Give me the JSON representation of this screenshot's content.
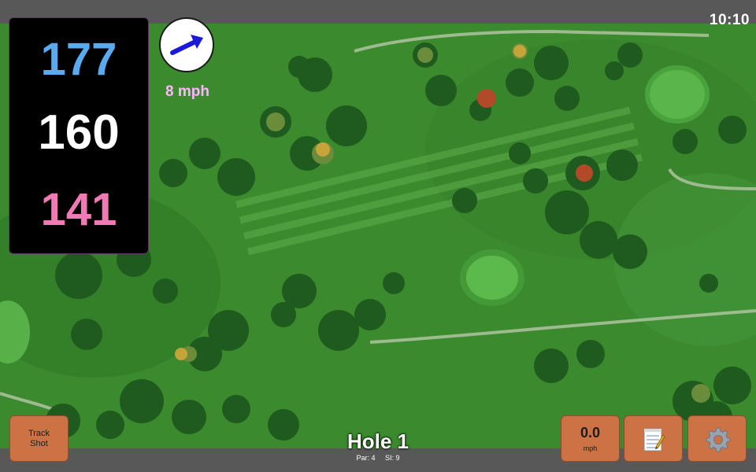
{
  "status": {
    "time": "10:10"
  },
  "distances": {
    "back": "177",
    "middle": "160",
    "front": "141"
  },
  "wind": {
    "speed_label": "8 mph",
    "direction_icon": "arrow-icon"
  },
  "track_button": {
    "line1": "Track",
    "line2": "Shot"
  },
  "hole": {
    "title": "Hole 1",
    "par": "Par: 4",
    "stroke_index": "SI: 9"
  },
  "speed_button": {
    "value": "0.0",
    "unit": "mph"
  },
  "notes_button": {
    "icon": "notepad-icon"
  },
  "settings_button": {
    "icon": "gear-icon"
  },
  "colors": {
    "back_distance": "#5aaaf0",
    "middle_distance": "#ffffff",
    "front_distance": "#f07ab4",
    "wind_text": "#ffb8ff",
    "button_bg": "#cc7244",
    "arrow": "#1a1ad8"
  }
}
